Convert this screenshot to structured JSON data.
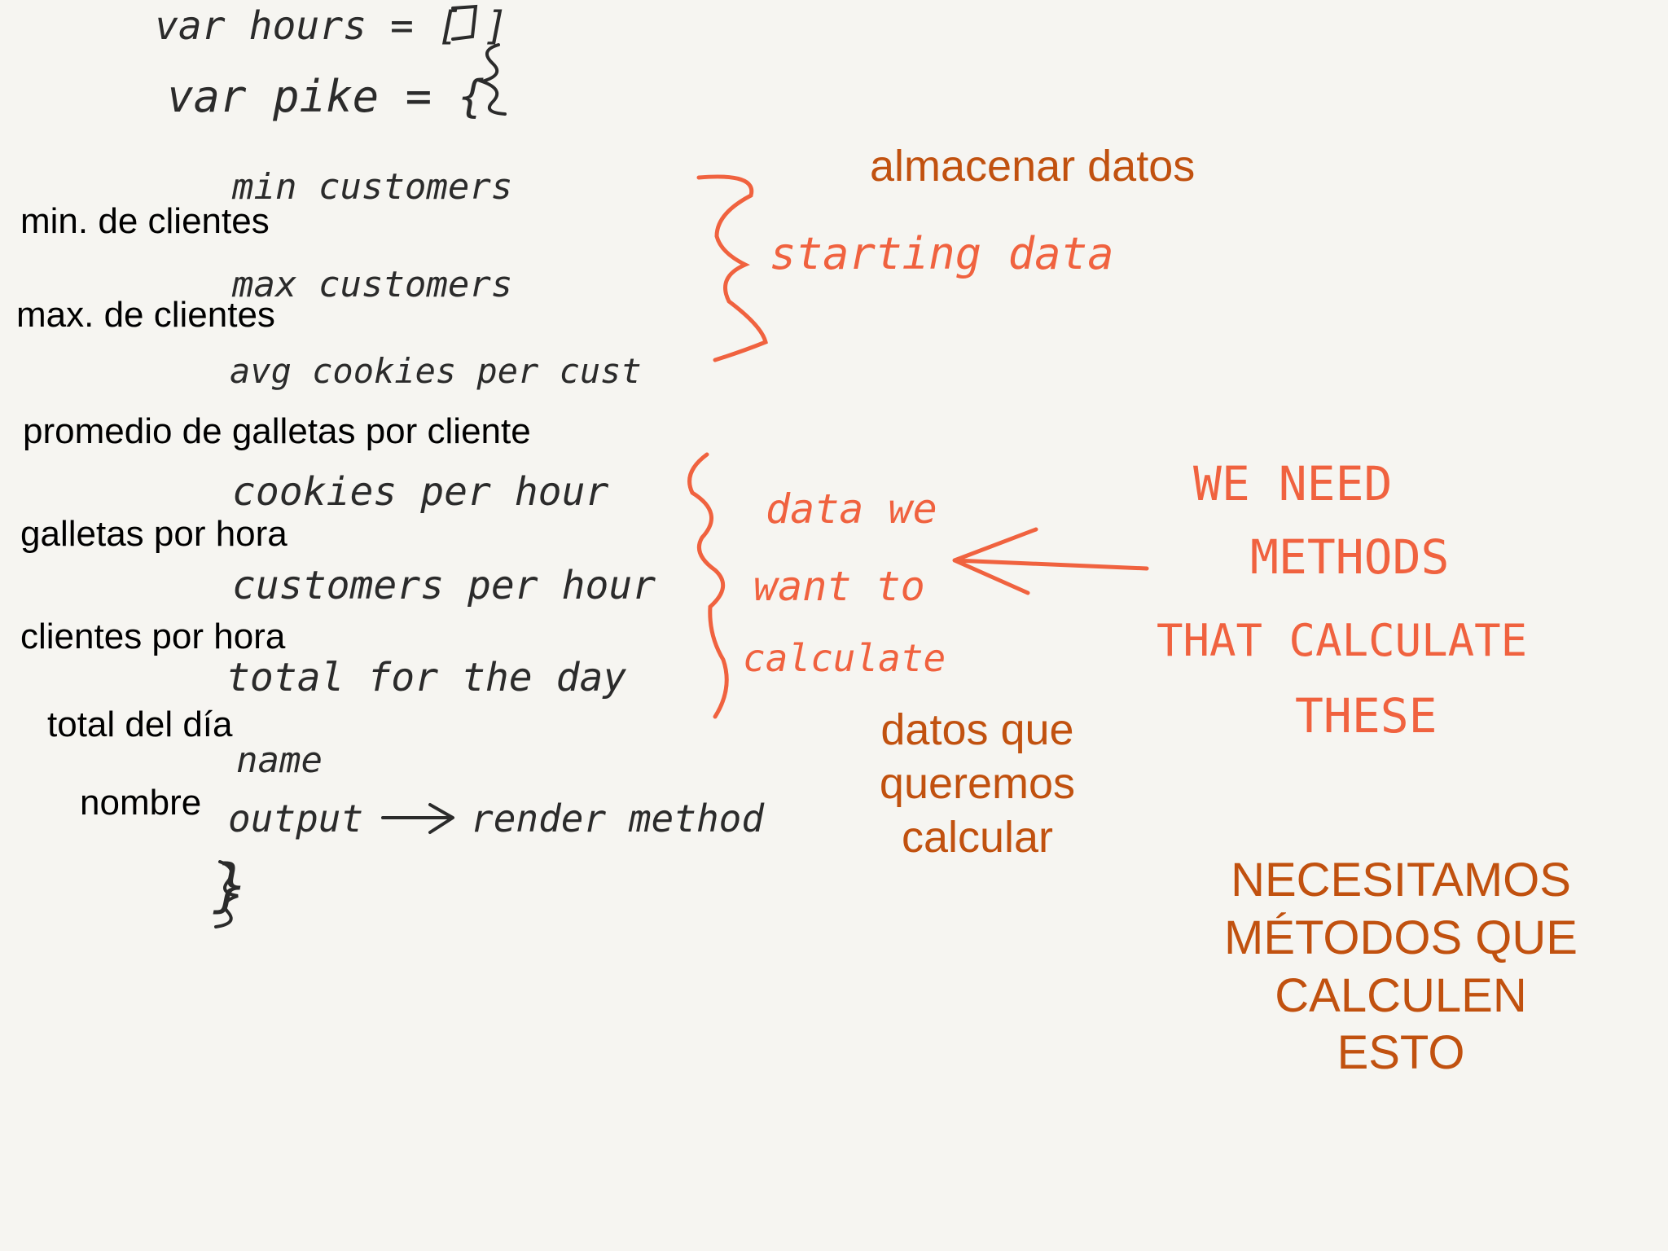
{
  "handwritten_code": {
    "line_hours": "var hours = [   ]",
    "line_pike": "var pike = {",
    "min_customers": "min customers",
    "max_customers": "max customers",
    "avg_cookies": "avg cookies per cust",
    "cookies_per_hour": "cookies per hour",
    "customers_per_hour": "customers per hour",
    "total_for_day": "total for the day",
    "name": "name",
    "output": "output",
    "render_method": "render method",
    "closing_brace": "}"
  },
  "handwritten_notes": {
    "starting_data": "starting data",
    "data_we_want_1": "data we",
    "data_we_want_2": "want to",
    "data_we_want_3": "calculate",
    "we_need_1": "WE NEED",
    "we_need_2": "METHODS",
    "we_need_3": "THAT CALCULATE",
    "we_need_4": "THESE"
  },
  "translations": {
    "min_clientes": "min. de clientes",
    "max_clientes": "max. de clientes",
    "promedio": "promedio de galletas por cliente",
    "galletas_hora": "galletas por hora",
    "clientes_hora": "clientes por hora",
    "total_dia": "total del día",
    "nombre": "nombre",
    "almacenar": "almacenar datos",
    "datos_que": "datos que\nqueremos\ncalcular",
    "necesitamos": "NECESITAMOS\nMÉTODOS QUE\nCALCULEN\nESTO"
  },
  "colors": {
    "background": "#f6f5f1",
    "ink_black": "#2b2b2b",
    "ink_orange": "#f0623f",
    "typed_orange": "#c1510f"
  }
}
